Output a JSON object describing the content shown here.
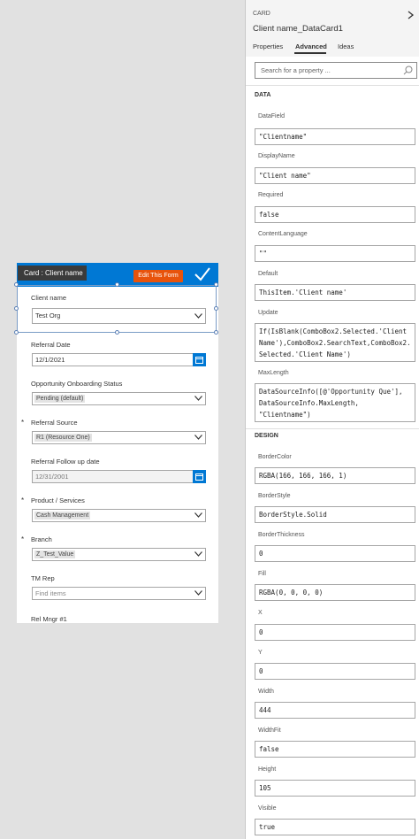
{
  "form": {
    "tooltip": "Card : Client name",
    "edit_button": "Edit This Form",
    "fields": [
      {
        "label": "Client name",
        "required": false,
        "value": "Test Org",
        "kind": "dropdown-text"
      },
      {
        "label": "Referral Date",
        "required": false,
        "value": "12/1/2021",
        "kind": "date"
      },
      {
        "label": "Opportunity Onboarding Status",
        "required": false,
        "value": "Pending (default)",
        "kind": "dropdown-pill"
      },
      {
        "label": "Referral Source",
        "required": true,
        "value": "R1 (Resource One)",
        "kind": "dropdown-pill"
      },
      {
        "label": "Referral Follow up date",
        "required": false,
        "value": "12/31/2001",
        "kind": "date-disabled"
      },
      {
        "label": "Product / Services",
        "required": true,
        "value": "Cash Management",
        "kind": "dropdown-pill"
      },
      {
        "label": "Branch",
        "required": true,
        "value": "Z_Test_Value",
        "kind": "dropdown-pill"
      },
      {
        "label": "TM Rep",
        "required": false,
        "value": "Find items",
        "kind": "dropdown-placeholder"
      },
      {
        "label": "Rel Mngr #1",
        "required": false,
        "value": "",
        "kind": "label-only"
      }
    ],
    "required_mark": "*"
  },
  "panel": {
    "card_type": "CARD",
    "card_name": "Client name_DataCard1",
    "tabs": [
      "Properties",
      "Advanced",
      "Ideas"
    ],
    "active_tab": "Advanced",
    "search_placeholder": "Search for a property ...",
    "sections": [
      {
        "title": "DATA",
        "properties": [
          {
            "name": "DataField",
            "value": "\"Clientname\""
          },
          {
            "name": "DisplayName",
            "value": "\"Client name\""
          },
          {
            "name": "Required",
            "value": "false"
          },
          {
            "name": "ContentLanguage",
            "value": "\"\""
          },
          {
            "name": "Default",
            "value": "ThisItem.'Client name'"
          },
          {
            "name": "Update",
            "value": "If(IsBlank(ComboBox2.Selected.'Client\nName'),ComboBox2.SearchText,ComboBox2.\nSelected.'Client Name')"
          },
          {
            "name": "MaxLength",
            "value": "DataSourceInfo([@'Opportunity Que'],\nDataSourceInfo.MaxLength,\n\"Clientname\")"
          }
        ]
      },
      {
        "title": "DESIGN",
        "properties": [
          {
            "name": "BorderColor",
            "value": "RGBA(166, 166, 166, 1)"
          },
          {
            "name": "BorderStyle",
            "value": "BorderStyle.Solid"
          },
          {
            "name": "BorderThickness",
            "value": "0"
          },
          {
            "name": "Fill",
            "value": "RGBA(0, 0, 0, 0)"
          },
          {
            "name": "X",
            "value": "0"
          },
          {
            "name": "Y",
            "value": "0"
          },
          {
            "name": "Width",
            "value": "444"
          },
          {
            "name": "WidthFit",
            "value": "false"
          },
          {
            "name": "Height",
            "value": "105"
          },
          {
            "name": "Visible",
            "value": "true"
          }
        ]
      }
    ]
  },
  "colors": {
    "accent": "#0078d4",
    "edit_button": "#e8530b",
    "tooltip_bg": "#3b3b3b",
    "canvas_bg": "#e1e1e1"
  },
  "icons": [
    "checkmark-icon",
    "chevron-down-icon",
    "calendar-icon",
    "search-icon",
    "expand-arrow-icon"
  ]
}
